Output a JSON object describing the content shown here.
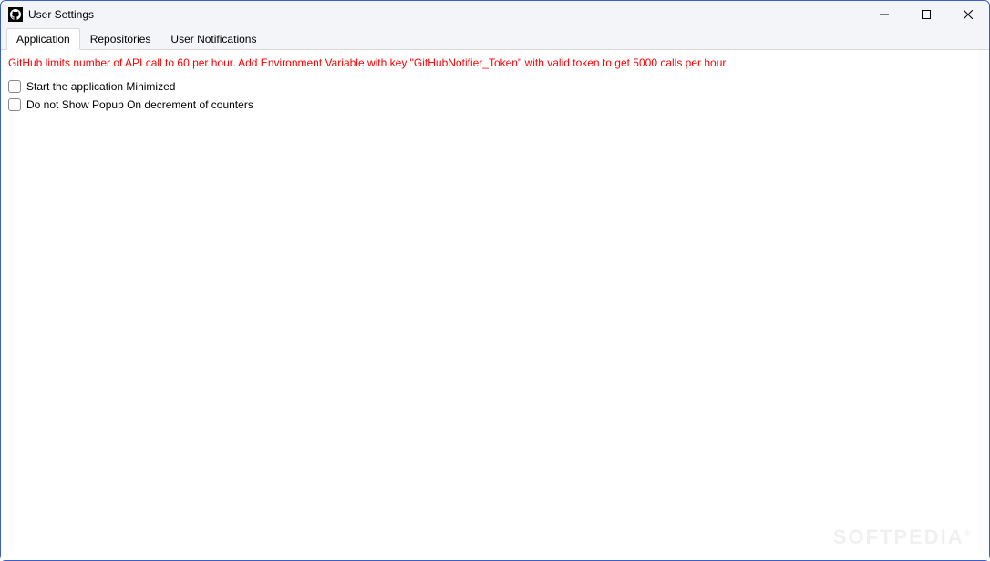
{
  "window": {
    "title": "User Settings"
  },
  "tabs": [
    {
      "label": "Application",
      "active": true
    },
    {
      "label": "Repositories",
      "active": false
    },
    {
      "label": "User Notifications",
      "active": false
    }
  ],
  "content": {
    "warning": "GitHub limits number of API call to 60 per hour. Add Environment Variable with key \"GitHubNotifier_Token\" with valid token to get 5000 calls per hour",
    "checkboxes": [
      {
        "label": "Start the application Minimized",
        "checked": false
      },
      {
        "label": "Do not Show Popup On decrement of counters",
        "checked": false
      }
    ]
  },
  "watermark": "SOFTPEDIA"
}
